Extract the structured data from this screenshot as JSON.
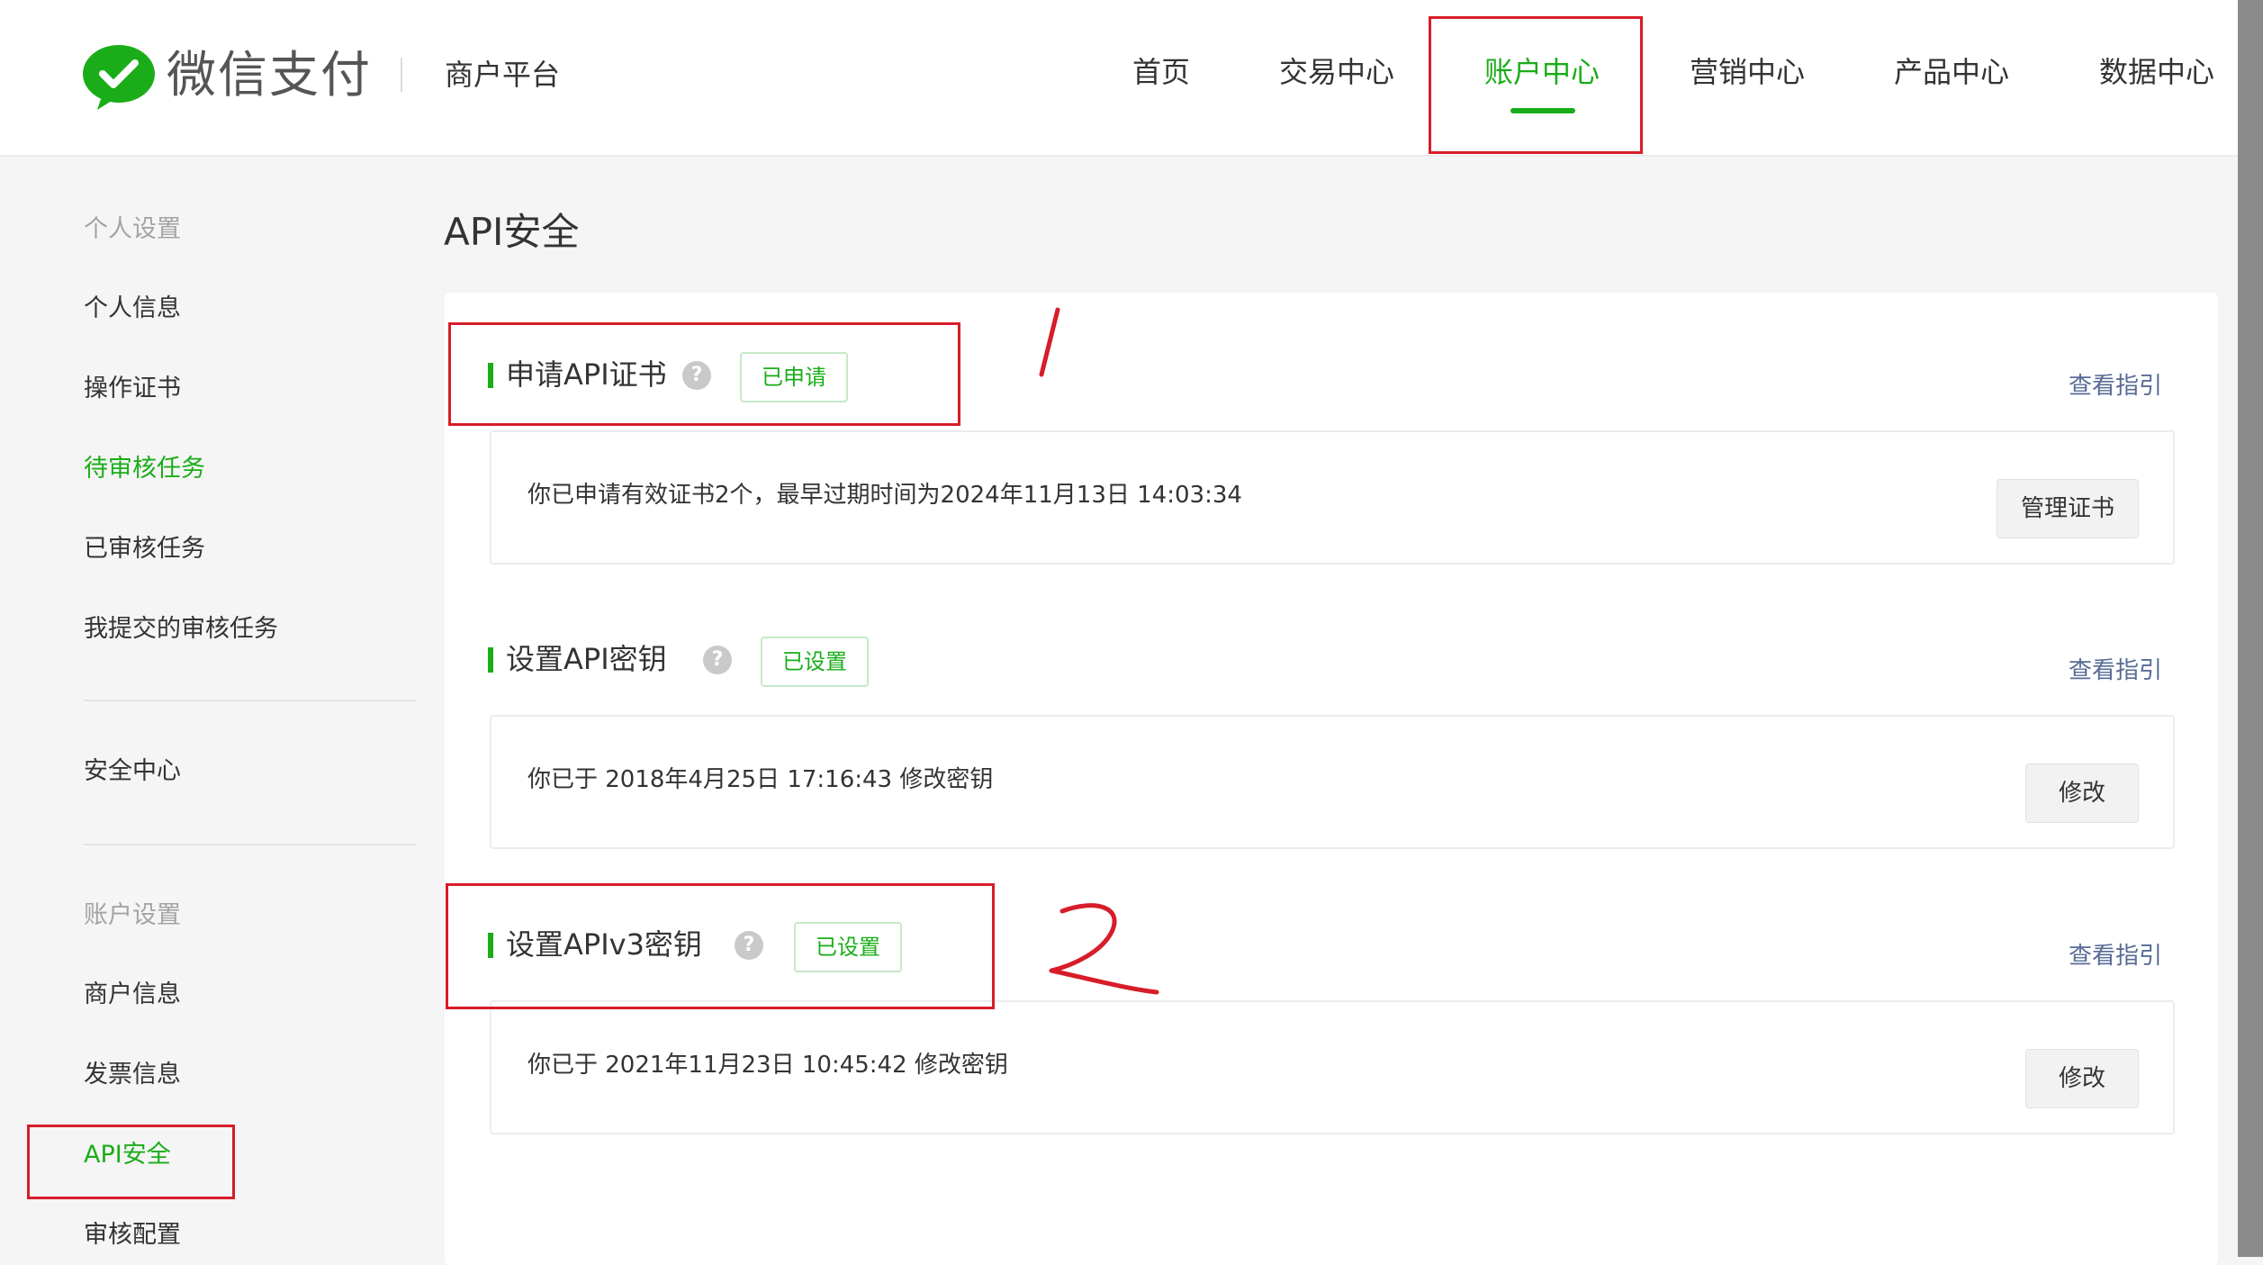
{
  "header": {
    "brand": "微信支付",
    "platform": "商户平台",
    "nav": [
      {
        "label": "首页"
      },
      {
        "label": "交易中心"
      },
      {
        "label": "账户中心",
        "active": true
      },
      {
        "label": "营销中心"
      },
      {
        "label": "产品中心"
      },
      {
        "label": "数据中心"
      }
    ]
  },
  "sidebar": {
    "group_personal": "个人设置",
    "items_personal": [
      "个人信息",
      "操作证书",
      "待审核任务",
      "已审核任务",
      "我提交的审核任务"
    ],
    "security_center": "安全中心",
    "group_account": "账户设置",
    "items_account": [
      "商户信息",
      "发票信息",
      "API安全",
      "审核配置"
    ],
    "active_item": "API安全"
  },
  "main": {
    "title": "API安全",
    "sections": [
      {
        "title": "申请API证书",
        "help": "?",
        "status": "已申请",
        "guide": "查看指引",
        "info": "你已申请有效证书2个，最早过期时间为2024年11月13日 14:03:34",
        "action": "管理证书"
      },
      {
        "title": "设置API密钥",
        "help": "?",
        "status": "已设置",
        "guide": "查看指引",
        "info": "你已于 2018年4月25日 17:16:43 修改密钥",
        "action": "修改"
      },
      {
        "title": "设置APIv3密钥",
        "help": "?",
        "status": "已设置",
        "guide": "查看指引",
        "info": "你已于 2021年11月23日 10:45:42 修改密钥",
        "action": "修改"
      }
    ]
  },
  "annotations": {
    "mark_1": "1",
    "mark_2": "2"
  },
  "colors": {
    "accent": "#1aad19",
    "link": "#576b95",
    "annotation": "#d71d2a"
  }
}
